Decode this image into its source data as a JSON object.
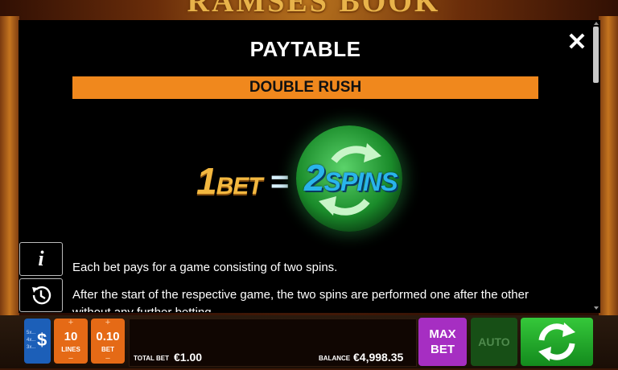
{
  "game": {
    "logo_text": "RAMSES BOOK"
  },
  "paytable": {
    "title": "PAYTABLE",
    "close_symbol": "✕",
    "section_heading": "DOUBLE RUSH",
    "illustration": {
      "left_number": "1",
      "left_word": "BET",
      "equals": "=",
      "right_number": "2",
      "right_word": "SPINS"
    },
    "paragraphs": [
      "Each bet pays for a game consisting of two spins.",
      "After the start of the respective game, the two spins are performed one after the other without any further betting."
    ]
  },
  "side_buttons": {
    "info_symbol": "i",
    "history_icon": "history-clock-icon"
  },
  "controls": {
    "multiplier_lines": [
      "5x...",
      "4x...",
      "3x..."
    ],
    "multiplier_symbol": "$",
    "lines": {
      "plus": "+",
      "value": "10",
      "label": "LINES",
      "minus": "−"
    },
    "bet": {
      "plus": "+",
      "value": "0.10",
      "label": "BET",
      "minus": "−"
    },
    "total_bet_label": "TOTAL BET",
    "total_bet_value": "€1.00",
    "balance_label": "BALANCE",
    "balance_value": "€4,998.35",
    "max_bet_line1": "MAX",
    "max_bet_line2": "BET",
    "auto_label": "AUTO",
    "spin_icon": "spin-arrows-icon"
  },
  "colors": {
    "section_bar": "#f0881d",
    "spin_button": "#35c83a",
    "max_bet_button": "#a62ec2",
    "lines_bet_buttons": "#e56a16",
    "multiplier_button": "#1c5fb8"
  }
}
